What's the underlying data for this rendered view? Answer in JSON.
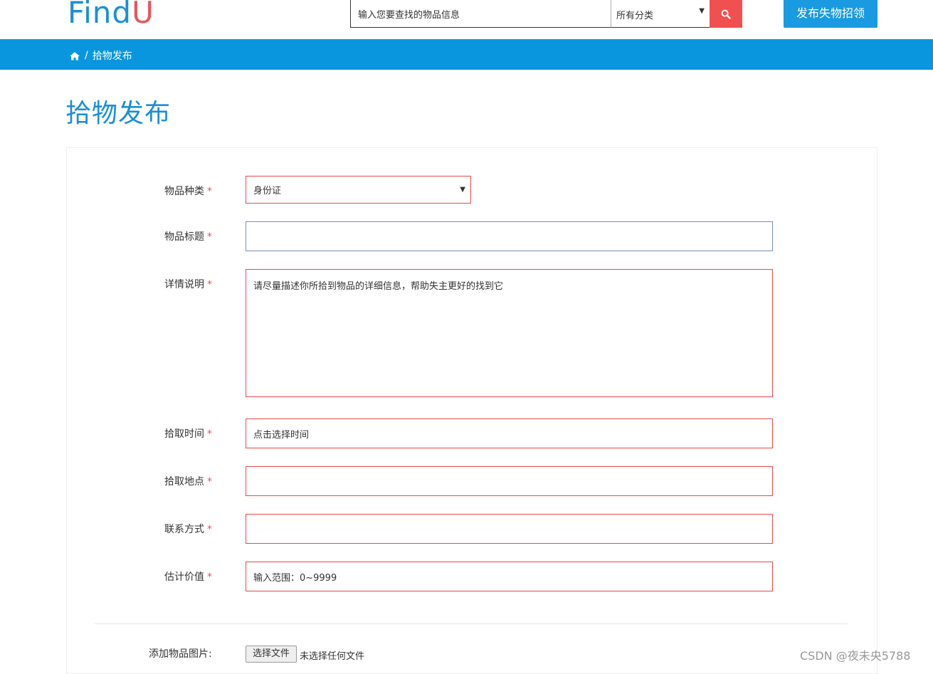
{
  "header": {
    "logo_main": "Find",
    "logo_accent": "U",
    "search_placeholder": "输入您要查找的物品信息",
    "category_selected": "所有分类",
    "post_lost_button": "发布失物招领"
  },
  "breadcrumb": {
    "separator": "/",
    "current": "拾物发布"
  },
  "page": {
    "title": "拾物发布"
  },
  "form": {
    "required_mark": "*",
    "category": {
      "label": "物品种类",
      "value": "身份证"
    },
    "title": {
      "label": "物品标题",
      "value": ""
    },
    "details": {
      "label": "详情说明",
      "placeholder": "请尽量描述你所拾到物品的详细信息，帮助失主更好的找到它"
    },
    "pickup_time": {
      "label": "拾取时间",
      "placeholder": "点击选择时间"
    },
    "pickup_place": {
      "label": "拾取地点",
      "value": ""
    },
    "contact": {
      "label": "联系方式",
      "value": ""
    },
    "value": {
      "label": "估计价值",
      "placeholder": "输入范围：0~9999"
    },
    "image": {
      "label": "添加物品图片:",
      "button": "选择文件",
      "status": "未选择任何文件"
    }
  },
  "watermark": "CSDN @夜未央5788",
  "colors": {
    "brand_blue": "#1a8fd6",
    "bar_blue": "#0a96de",
    "accent_red": "#e8555a",
    "search_red": "#f05050",
    "invalid_border": "#e64b4b"
  },
  "icons": {
    "search": "search-icon",
    "home": "home-icon",
    "dropdown": "triangle-down-icon"
  }
}
